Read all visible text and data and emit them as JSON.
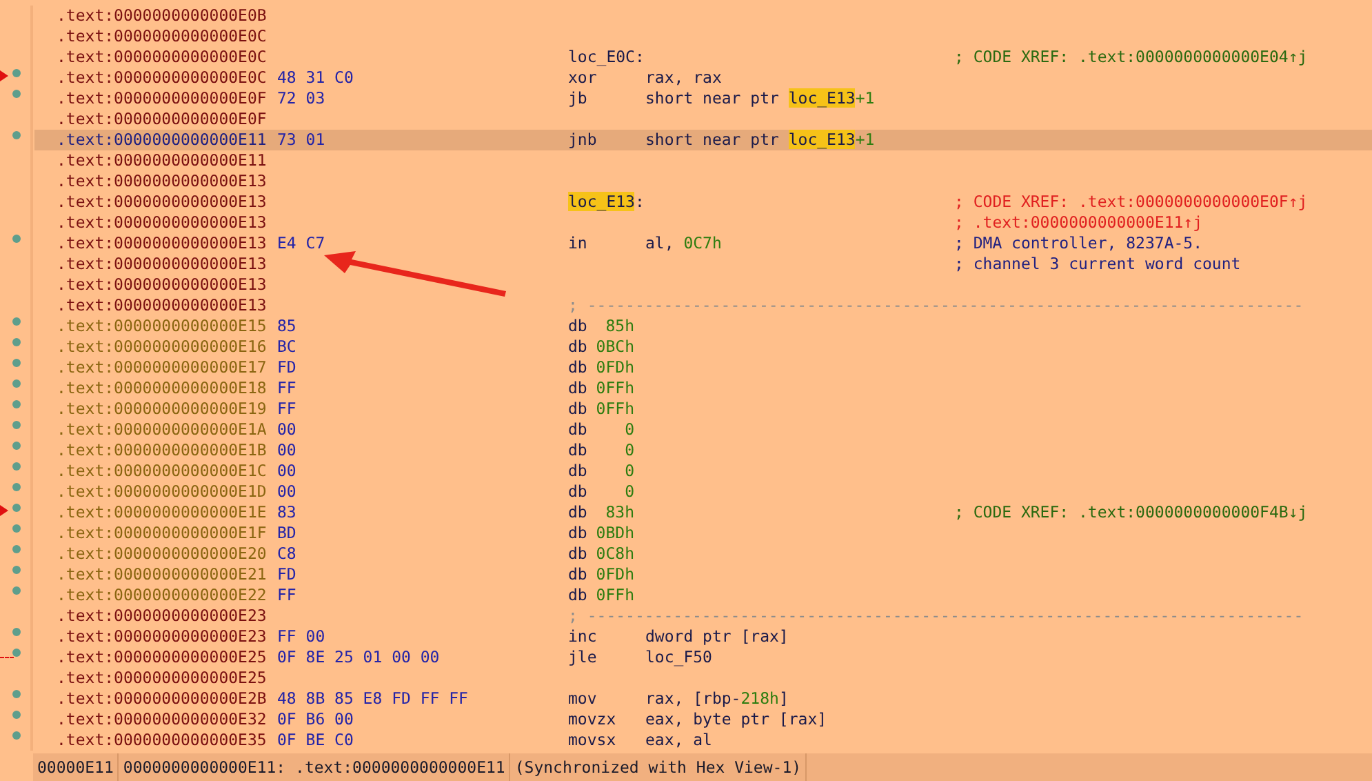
{
  "listing": {
    "rows": [
      {
        "kind": "blank",
        "address": ".text:0000000000000E0B",
        "selected": false,
        "breakpoint": false,
        "arrow": false,
        "dashed": false
      },
      {
        "kind": "blank",
        "address": ".text:0000000000000E0C",
        "selected": false,
        "breakpoint": false,
        "arrow": false,
        "dashed": false
      },
      {
        "kind": "label",
        "address": ".text:0000000000000E0C",
        "label": [
          {
            "text": "loc_E0C",
            "kind": "plain"
          },
          {
            "text": ":",
            "kind": "plain"
          }
        ],
        "comment": {
          "text": "; CODE XREF: .text:0000000000000E04↑j",
          "kind": "xref"
        },
        "selected": false,
        "breakpoint": false,
        "arrow": false,
        "dashed": false
      },
      {
        "kind": "code",
        "address": ".text:0000000000000E0C",
        "bytes": "48 31 C0",
        "mnemonic": "xor",
        "operands": [
          {
            "text": "rax, rax",
            "kind": "plain"
          }
        ],
        "selected": false,
        "breakpoint": true,
        "arrow": true,
        "dashed": false
      },
      {
        "kind": "code",
        "address": ".text:0000000000000E0F",
        "bytes": "72 03",
        "mnemonic": "jb",
        "operands": [
          {
            "text": "short near ptr ",
            "kind": "plain"
          },
          {
            "text": "loc_E13",
            "kind": "highlight"
          },
          {
            "text": "+1",
            "kind": "number"
          }
        ],
        "selected": false,
        "breakpoint": true,
        "arrow": false,
        "dashed": false
      },
      {
        "kind": "blank",
        "address": ".text:0000000000000E0F",
        "selected": false,
        "breakpoint": false,
        "arrow": false,
        "dashed": false
      },
      {
        "kind": "code",
        "address": ".text:0000000000000E11",
        "bytes": "73 01",
        "mnemonic": "jnb",
        "operands": [
          {
            "text": "short near ptr ",
            "kind": "plain"
          },
          {
            "text": "loc_E13",
            "kind": "highlight"
          },
          {
            "text": "+1",
            "kind": "number"
          }
        ],
        "selected": true,
        "breakpoint": true,
        "arrow": false,
        "dashed": false
      },
      {
        "kind": "blank",
        "address": ".text:0000000000000E11",
        "selected": false,
        "breakpoint": false,
        "arrow": false,
        "dashed": false
      },
      {
        "kind": "blank",
        "address": ".text:0000000000000E13",
        "selected": false,
        "breakpoint": false,
        "arrow": false,
        "dashed": false
      },
      {
        "kind": "label",
        "address": ".text:0000000000000E13",
        "label": [
          {
            "text": "loc_E13",
            "kind": "highlight"
          },
          {
            "text": ":",
            "kind": "plain"
          }
        ],
        "comment": {
          "text": "; CODE XREF: .text:0000000000000E0F↑j",
          "kind": "xref-red"
        },
        "selected": false,
        "breakpoint": false,
        "arrow": false,
        "dashed": false
      },
      {
        "kind": "note",
        "address": ".text:0000000000000E13",
        "comment": {
          "text": "; .text:0000000000000E11↑j",
          "kind": "xref-red"
        },
        "selected": false,
        "breakpoint": false,
        "arrow": false,
        "dashed": false
      },
      {
        "kind": "code",
        "address": ".text:0000000000000E13",
        "bytes": "E4 C7",
        "mnemonic": "in",
        "operands": [
          {
            "text": "al, ",
            "kind": "plain"
          },
          {
            "text": "0C7h",
            "kind": "number"
          }
        ],
        "comment": {
          "text": "; DMA controller, 8237A-5.",
          "kind": "note"
        },
        "selected": false,
        "breakpoint": true,
        "arrow": false,
        "dashed": false
      },
      {
        "kind": "note",
        "address": ".text:0000000000000E13",
        "comment": {
          "text": "; channel 3 current word count",
          "kind": "note"
        },
        "selected": false,
        "breakpoint": false,
        "arrow": false,
        "dashed": false
      },
      {
        "kind": "blank",
        "address": ".text:0000000000000E13",
        "selected": false,
        "breakpoint": false,
        "arrow": false,
        "dashed": false
      },
      {
        "kind": "separator",
        "address": ".text:0000000000000E13",
        "separator": "; ---------------------------------------------------------------------------",
        "selected": false,
        "breakpoint": false,
        "arrow": false,
        "dashed": false
      },
      {
        "kind": "data",
        "address": ".text:0000000000000E15",
        "bytes": "85",
        "mnemonic": "db",
        "value": "85h",
        "selected": false,
        "breakpoint": true,
        "arrow": false,
        "dashed": false
      },
      {
        "kind": "data",
        "address": ".text:0000000000000E16",
        "bytes": "BC",
        "mnemonic": "db",
        "value": "0BCh",
        "selected": false,
        "breakpoint": true,
        "arrow": false,
        "dashed": false
      },
      {
        "kind": "data",
        "address": ".text:0000000000000E17",
        "bytes": "FD",
        "mnemonic": "db",
        "value": "0FDh",
        "selected": false,
        "breakpoint": true,
        "arrow": false,
        "dashed": false
      },
      {
        "kind": "data",
        "address": ".text:0000000000000E18",
        "bytes": "FF",
        "mnemonic": "db",
        "value": "0FFh",
        "selected": false,
        "breakpoint": true,
        "arrow": false,
        "dashed": false
      },
      {
        "kind": "data",
        "address": ".text:0000000000000E19",
        "bytes": "FF",
        "mnemonic": "db",
        "value": "0FFh",
        "selected": false,
        "breakpoint": true,
        "arrow": false,
        "dashed": false
      },
      {
        "kind": "data",
        "address": ".text:0000000000000E1A",
        "bytes": "00",
        "mnemonic": "db",
        "value": "0",
        "selected": false,
        "breakpoint": true,
        "arrow": false,
        "dashed": false
      },
      {
        "kind": "data",
        "address": ".text:0000000000000E1B",
        "bytes": "00",
        "mnemonic": "db",
        "value": "0",
        "selected": false,
        "breakpoint": true,
        "arrow": false,
        "dashed": false
      },
      {
        "kind": "data",
        "address": ".text:0000000000000E1C",
        "bytes": "00",
        "mnemonic": "db",
        "value": "0",
        "selected": false,
        "breakpoint": true,
        "arrow": false,
        "dashed": false
      },
      {
        "kind": "data",
        "address": ".text:0000000000000E1D",
        "bytes": "00",
        "mnemonic": "db",
        "value": "0",
        "selected": false,
        "breakpoint": true,
        "arrow": false,
        "dashed": false
      },
      {
        "kind": "data",
        "address": ".text:0000000000000E1E",
        "bytes": "83",
        "mnemonic": "db",
        "value": "83h",
        "comment": {
          "text": "; CODE XREF: .text:0000000000000F4B↓j",
          "kind": "xref"
        },
        "selected": false,
        "breakpoint": true,
        "arrow": true,
        "dashed": false
      },
      {
        "kind": "data",
        "address": ".text:0000000000000E1F",
        "bytes": "BD",
        "mnemonic": "db",
        "value": "0BDh",
        "selected": false,
        "breakpoint": true,
        "arrow": false,
        "dashed": false
      },
      {
        "kind": "data",
        "address": ".text:0000000000000E20",
        "bytes": "C8",
        "mnemonic": "db",
        "value": "0C8h",
        "selected": false,
        "breakpoint": true,
        "arrow": false,
        "dashed": false
      },
      {
        "kind": "data",
        "address": ".text:0000000000000E21",
        "bytes": "FD",
        "mnemonic": "db",
        "value": "0FDh",
        "selected": false,
        "breakpoint": true,
        "arrow": false,
        "dashed": false
      },
      {
        "kind": "data",
        "address": ".text:0000000000000E22",
        "bytes": "FF",
        "mnemonic": "db",
        "value": "0FFh",
        "selected": false,
        "breakpoint": true,
        "arrow": false,
        "dashed": false
      },
      {
        "kind": "separator",
        "address": ".text:0000000000000E23",
        "separator": "; ---------------------------------------------------------------------------",
        "selected": false,
        "breakpoint": false,
        "arrow": false,
        "dashed": false
      },
      {
        "kind": "code",
        "address": ".text:0000000000000E23",
        "bytes": "FF 00",
        "mnemonic": "inc",
        "operands": [
          {
            "text": "dword ptr [rax]",
            "kind": "plain"
          }
        ],
        "selected": false,
        "breakpoint": true,
        "arrow": false,
        "dashed": false
      },
      {
        "kind": "code",
        "address": ".text:0000000000000E25",
        "bytes": "0F 8E 25 01 00 00",
        "mnemonic": "jle",
        "operands": [
          {
            "text": "loc_F50",
            "kind": "plain"
          }
        ],
        "selected": false,
        "breakpoint": true,
        "arrow": false,
        "dashed": true
      },
      {
        "kind": "blank",
        "address": ".text:0000000000000E25",
        "selected": false,
        "breakpoint": false,
        "arrow": false,
        "dashed": false
      },
      {
        "kind": "code",
        "address": ".text:0000000000000E2B",
        "bytes": "48 8B 85 E8 FD FF FF",
        "mnemonic": "mov",
        "operands": [
          {
            "text": "rax, [rbp-",
            "kind": "plain"
          },
          {
            "text": "218h",
            "kind": "number"
          },
          {
            "text": "]",
            "kind": "plain"
          }
        ],
        "selected": false,
        "breakpoint": true,
        "arrow": false,
        "dashed": false
      },
      {
        "kind": "code",
        "address": ".text:0000000000000E32",
        "bytes": "0F B6 00",
        "mnemonic": "movzx",
        "operands": [
          {
            "text": "eax, byte ptr [rax]",
            "kind": "plain"
          }
        ],
        "selected": false,
        "breakpoint": true,
        "arrow": false,
        "dashed": false
      },
      {
        "kind": "code",
        "address": ".text:0000000000000E35",
        "bytes": "0F BE C0",
        "mnemonic": "movsx",
        "operands": [
          {
            "text": "eax, al",
            "kind": "plain"
          }
        ],
        "selected": false,
        "breakpoint": true,
        "arrow": false,
        "dashed": false
      }
    ]
  },
  "status_bar": [
    "00000E11",
    "0000000000000E11: .text:0000000000000E11",
    "(Synchronized with Hex View-1)"
  ]
}
